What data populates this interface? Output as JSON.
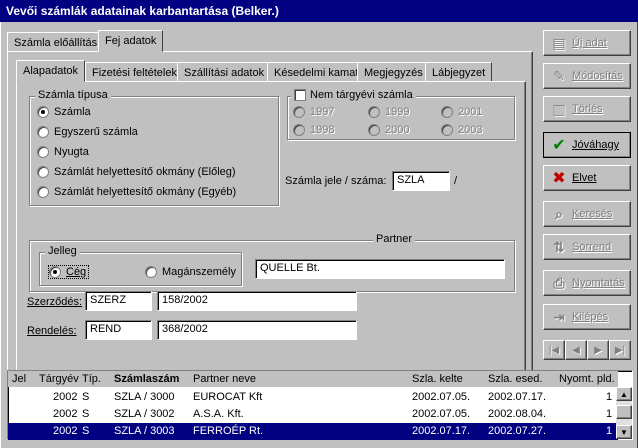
{
  "window": {
    "title": "Vevői számlák adatainak karbantartása (Belker.)"
  },
  "outer_tabs": [
    "Számla előállítás",
    "Fej adatok"
  ],
  "inner_tabs": [
    "Alapadatok",
    "Fizetési feltételek",
    "Szállítási adatok",
    "Késedelmi kamat",
    "Megjegyzés",
    "Lábjegyzet"
  ],
  "szamla_tipusa": {
    "title": "Számla típusa",
    "options": [
      "Számla",
      "Egyszerű számla",
      "Nyugta",
      "Számlát helyettesítő okmány (Előleg)",
      "Számlát helyettesítő okmány (Egyéb)"
    ],
    "selected": "Számla"
  },
  "nem_targyevi": {
    "title": "Nem tárgyévi számla",
    "years": [
      "1997",
      "1999",
      "2001",
      "1998",
      "2000",
      "2003"
    ]
  },
  "szamla_jele": {
    "label": "Számla jele / száma:",
    "value": "SZLA",
    "separator": "/"
  },
  "partner": {
    "title": "Partner",
    "value": "QUELLE Bt.",
    "jelleg": {
      "title": "Jelleg",
      "options": [
        "Cég",
        "Magánszemély"
      ],
      "selected": "Cég"
    }
  },
  "szerzodes": {
    "label": "Szerződés:",
    "code": "SZERZ",
    "number": "158/2002"
  },
  "rendeles": {
    "label": "Rendelés:",
    "code": "REND",
    "number": "368/2002"
  },
  "buttons": [
    {
      "label": "Új adat",
      "icon": "new-doc-icon",
      "enabled": false
    },
    {
      "label": "Módosítás",
      "icon": "edit-icon",
      "enabled": false
    },
    {
      "label": "Törlés",
      "icon": "trash-icon",
      "enabled": false
    },
    {
      "label": "Jóváhagy",
      "icon": "checkmark-icon",
      "enabled": true,
      "color": "#008000"
    },
    {
      "label": "Elvet",
      "icon": "x-icon",
      "enabled": true,
      "color": "#c00000"
    },
    {
      "label": "Keresés",
      "icon": "search-icon",
      "enabled": false
    },
    {
      "label": "Sorrend",
      "icon": "sort-icon",
      "enabled": false
    },
    {
      "label": "Nyomtatás",
      "icon": "printer-icon",
      "enabled": false
    },
    {
      "label": "Kilépés",
      "icon": "exit-icon",
      "enabled": false
    }
  ],
  "nav": [
    "first",
    "prev",
    "next",
    "last"
  ],
  "grid": {
    "columns": [
      "Jel",
      "Tárgyév",
      "Típ.",
      "Számlaszám",
      "Partner neve",
      "Szla. kelte",
      "Szla. esed.",
      "Nyomt. pld."
    ],
    "rows": [
      {
        "jel": "",
        "targyev": "2002",
        "tip": "S",
        "szamlaszam": "SZLA / 3000",
        "partner": "EUROCAT Kft",
        "kelte": "2002.07.05.",
        "esed": "2002.07.17.",
        "pld": "1"
      },
      {
        "jel": "",
        "targyev": "2002",
        "tip": "S",
        "szamlaszam": "SZLA / 3002",
        "partner": "A.S.A. Kft.",
        "kelte": "2002.07.05.",
        "esed": "2002.08.04.",
        "pld": "1"
      },
      {
        "jel": "",
        "targyev": "2002",
        "tip": "S",
        "szamlaszam": "SZLA / 3003",
        "partner": "FERROÉP Rt.",
        "kelte": "2002.07.17.",
        "esed": "2002.07.27.",
        "pld": "1"
      }
    ],
    "selected_row": 2
  }
}
